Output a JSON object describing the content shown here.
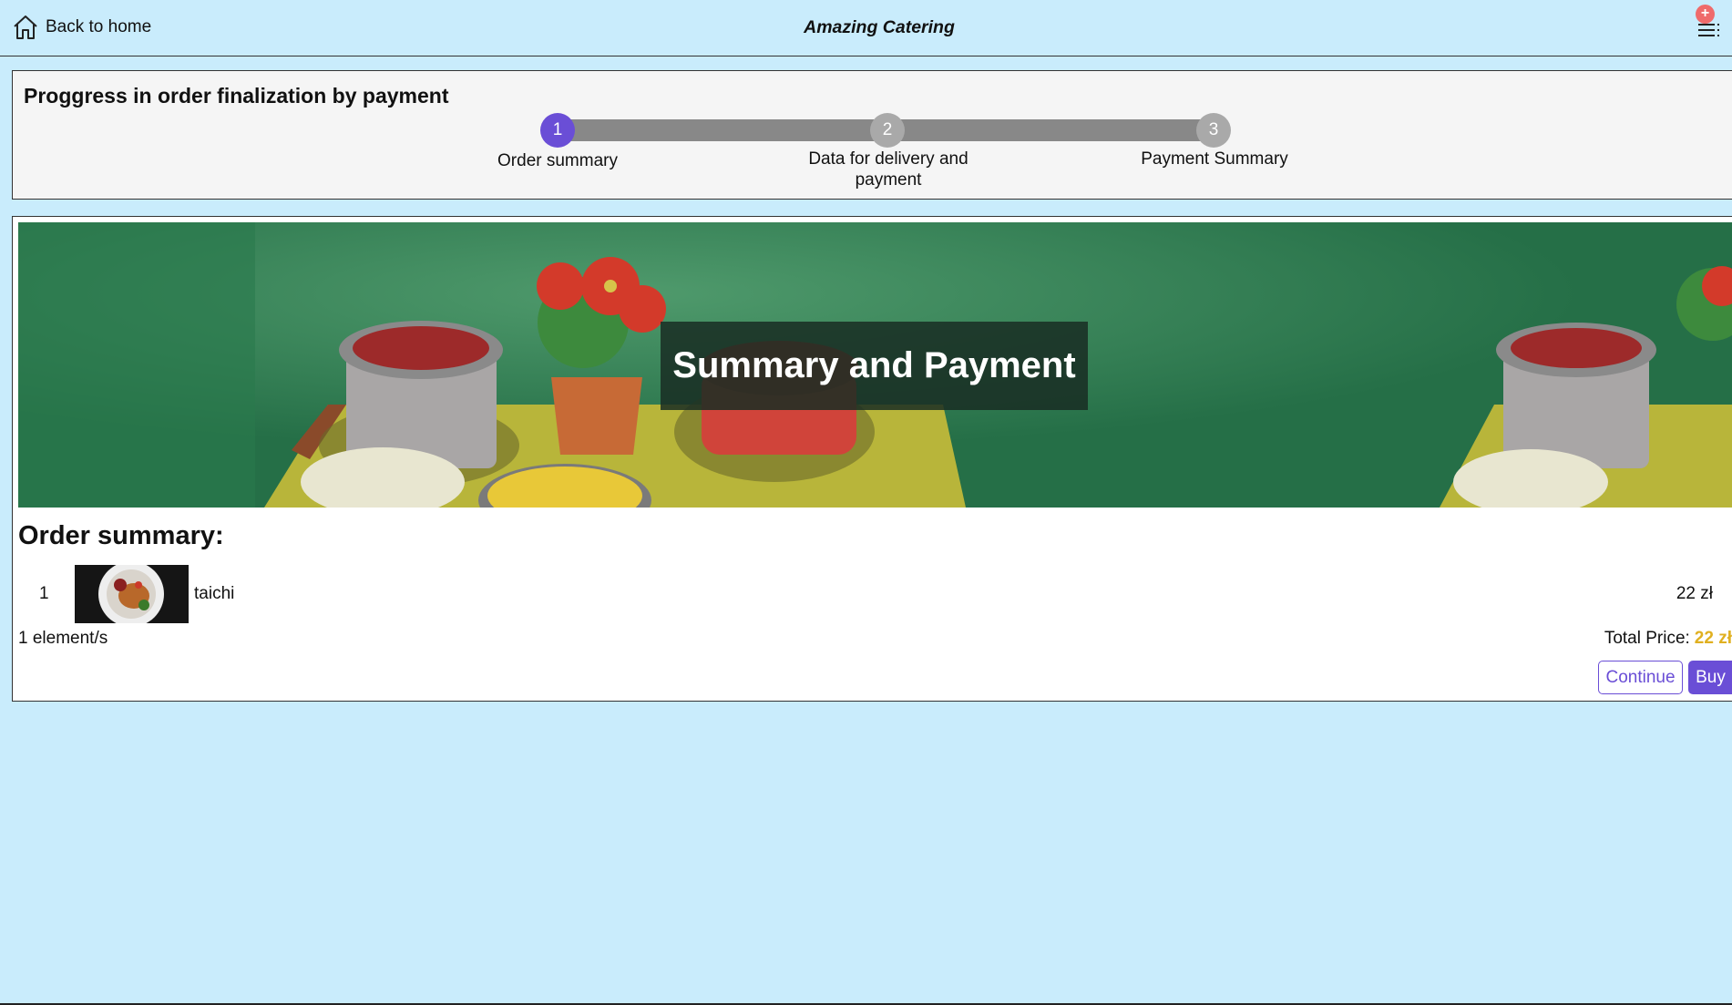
{
  "header": {
    "back_label": "Back to home",
    "app_title": "Amazing Catering",
    "menu_badge": "+"
  },
  "progress": {
    "title": "Proggress in order finalization by payment",
    "current_step": 1,
    "steps": [
      {
        "number": "1",
        "label": "Order summary"
      },
      {
        "number": "2",
        "label": "Data for delivery and payment"
      },
      {
        "number": "3",
        "label": "Payment Summary"
      }
    ]
  },
  "banner": {
    "title": "Summary and Payment"
  },
  "order": {
    "section_title": "Order summary:",
    "items": [
      {
        "index": "1",
        "name": "taichi",
        "price": "22 zł"
      }
    ],
    "count_text": "1 element/s",
    "total_label": "Total Price:",
    "total_value": "22 zł"
  },
  "actions": {
    "continue_label": "Continue",
    "buy_label": "Buy"
  },
  "colors": {
    "background": "#c9ecfc",
    "accent": "#6a4ed6",
    "price_highlight": "#e0b020",
    "inactive_step": "#a9a9a9"
  }
}
